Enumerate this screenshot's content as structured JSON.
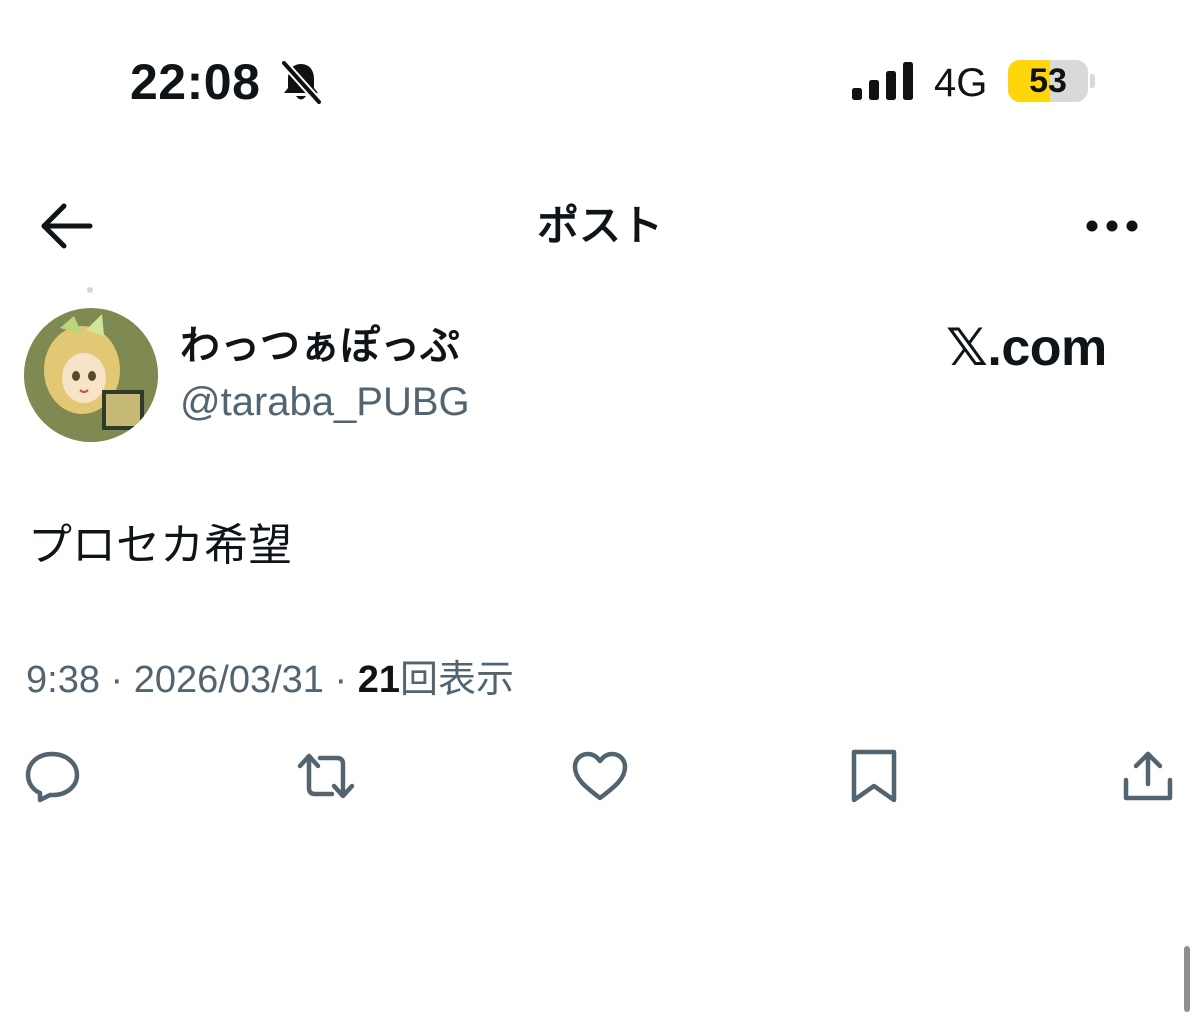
{
  "status_bar": {
    "time": "22:08",
    "network": "4G",
    "battery_level": "53",
    "battery_fraction": 0.53,
    "icons": [
      "bell-slash-icon",
      "cellular-signal-icon",
      "battery-icon"
    ]
  },
  "header": {
    "title": "ポスト",
    "icons": [
      "arrow-left-icon",
      "ellipsis-icon"
    ]
  },
  "author": {
    "display_name": "わっつぁぽっぷ",
    "handle": "@taraba_PUBG"
  },
  "watermark": "𝕏.com",
  "post": {
    "text": "プロセカ希望",
    "time": "9:38",
    "sep": " · ",
    "date": "2026/03/31",
    "views_count": "21",
    "views_label": "回表示"
  },
  "actions": [
    "reply-icon",
    "repost-icon",
    "heart-icon",
    "bookmark-icon",
    "share-icon"
  ],
  "colors": {
    "text": "#0f1419",
    "secondary": "#536471",
    "battery_fill": "#ffd60a"
  }
}
